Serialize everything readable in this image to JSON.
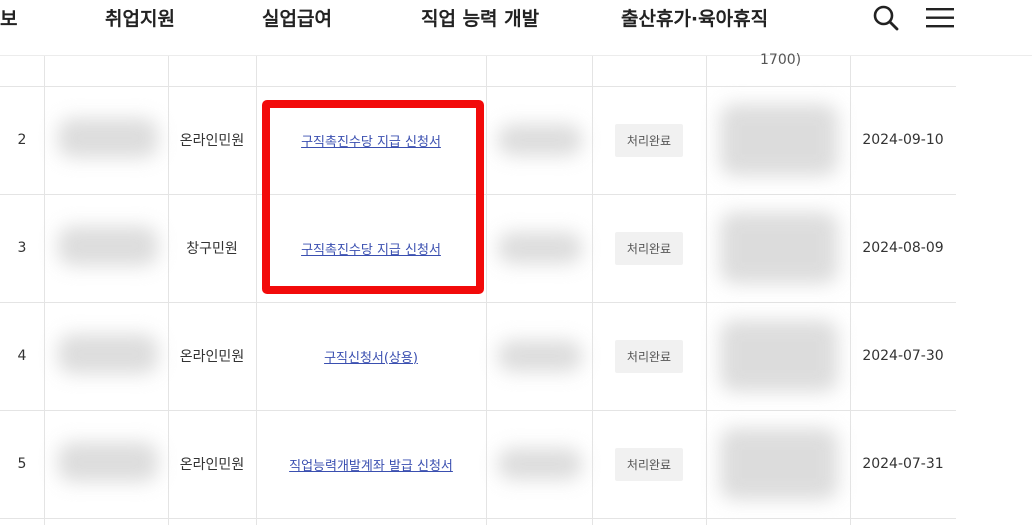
{
  "nav": {
    "items": [
      {
        "label": "보"
      },
      {
        "label": "취업지원"
      },
      {
        "label": "실업급여"
      },
      {
        "label": "직업 능력 개발"
      },
      {
        "label": "출산휴가·육아휴직"
      }
    ],
    "search_icon": "search-icon",
    "menu_icon": "hamburger-menu-icon"
  },
  "table": {
    "top_partial_text": "1700)",
    "rows": [
      {
        "no": "2",
        "type": "온라인민원",
        "title": "구직촉진수당 지급 신청서",
        "status": "처리완료",
        "date": "2024-09-10"
      },
      {
        "no": "3",
        "type": "창구민원",
        "title": "구직촉진수당 지급 신청서",
        "status": "처리완료",
        "date": "2024-08-09"
      },
      {
        "no": "4",
        "type": "온라인민원",
        "title": "구직신청서(상용)",
        "status": "처리완료",
        "date": "2024-07-30"
      },
      {
        "no": "5",
        "type": "온라인민원",
        "title": "직업능력개발계좌 발급 신청서",
        "status": "처리완료",
        "date": "2024-07-31"
      }
    ]
  },
  "colors": {
    "highlight": "#f20a0a",
    "link": "#3a4fb0"
  }
}
